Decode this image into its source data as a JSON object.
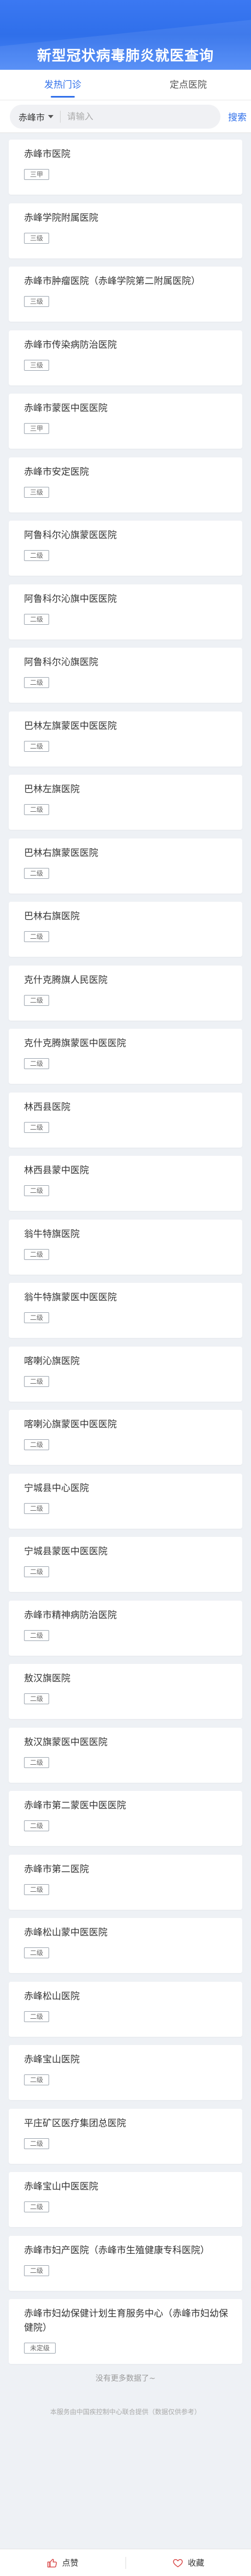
{
  "header": {
    "title": "新型冠状病毒肺炎就医查询"
  },
  "tabs": [
    {
      "label": "发热门诊"
    },
    {
      "label": "定点医院"
    }
  ],
  "search": {
    "city": "赤峰市",
    "placeholder": "请输入",
    "button": "搜索"
  },
  "hospitals": [
    {
      "name": "赤峰市医院",
      "level": "三甲"
    },
    {
      "name": "赤峰学院附属医院",
      "level": "三级"
    },
    {
      "name": "赤峰市肿瘤医院（赤峰学院第二附属医院）",
      "level": "三级"
    },
    {
      "name": "赤峰市传染病防治医院",
      "level": "三级"
    },
    {
      "name": "赤峰市蒙医中医医院",
      "level": "三甲"
    },
    {
      "name": "赤峰市安定医院",
      "level": "三级"
    },
    {
      "name": "阿鲁科尔沁旗蒙医医院",
      "level": "二级"
    },
    {
      "name": "阿鲁科尔沁旗中医医院",
      "level": "二级"
    },
    {
      "name": "阿鲁科尔沁旗医院",
      "level": "二级"
    },
    {
      "name": "巴林左旗蒙医中医医院",
      "level": "二级"
    },
    {
      "name": "巴林左旗医院",
      "level": "二级"
    },
    {
      "name": "巴林右旗蒙医医院",
      "level": "二级"
    },
    {
      "name": "巴林右旗医院",
      "level": "二级"
    },
    {
      "name": "克什克腾旗人民医院",
      "level": "二级"
    },
    {
      "name": "克什克腾旗蒙医中医医院",
      "level": "二级"
    },
    {
      "name": "林西县医院",
      "level": "二级"
    },
    {
      "name": "林西县蒙中医院",
      "level": "二级"
    },
    {
      "name": "翁牛特旗医院",
      "level": "二级"
    },
    {
      "name": "翁牛特旗蒙医中医医院",
      "level": "二级"
    },
    {
      "name": "喀喇沁旗医院",
      "level": "二级"
    },
    {
      "name": "喀喇沁旗蒙医中医医院",
      "level": "二级"
    },
    {
      "name": "宁城县中心医院",
      "level": "二级"
    },
    {
      "name": "宁城县蒙医中医医院",
      "level": "二级"
    },
    {
      "name": "赤峰市精神病防治医院",
      "level": "二级"
    },
    {
      "name": "敖汉旗医院",
      "level": "二级"
    },
    {
      "name": "敖汉旗蒙医中医医院",
      "level": "二级"
    },
    {
      "name": "赤峰市第二蒙医中医医院",
      "level": "二级"
    },
    {
      "name": "赤峰市第二医院",
      "level": "二级"
    },
    {
      "name": "赤峰松山蒙中医医院",
      "level": "二级"
    },
    {
      "name": "赤峰松山医院",
      "level": "二级"
    },
    {
      "name": "赤峰宝山医院",
      "level": "二级"
    },
    {
      "name": "平庄矿区医疗集团总医院",
      "level": "二级"
    },
    {
      "name": "赤峰宝山中医医院",
      "level": "二级"
    },
    {
      "name": "赤峰市妇产医院（赤峰市生殖健康专科医院）",
      "level": "二级"
    },
    {
      "name": "赤峰市妇幼保健计划生育服务中心（赤峰市妇幼保健院）",
      "level": "未定级"
    }
  ],
  "list_end": "没有更多数据了~",
  "source_note": "本服务由中国疾控制中心联合提供（数据仅供参考）",
  "footer": {
    "like_label": "点赞",
    "favorite_label": "收藏"
  },
  "colors": {
    "brand": "#2f6fea",
    "background": "#eef1f5"
  }
}
